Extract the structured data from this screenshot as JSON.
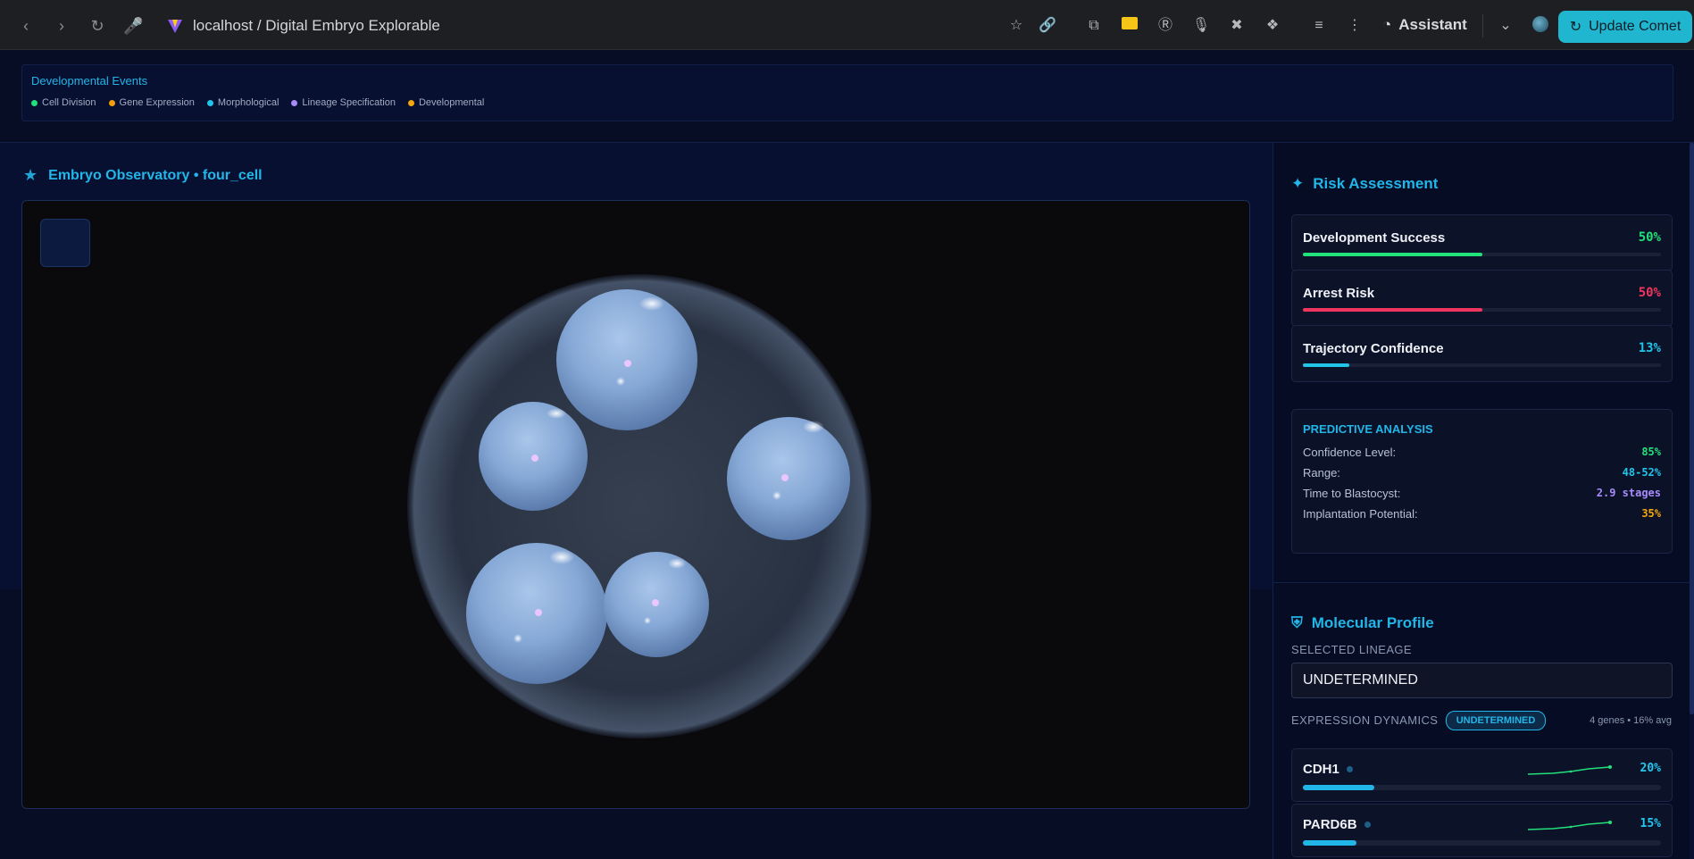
{
  "browser": {
    "url": "localhost / Digital Embryo Explorable",
    "assistant_label": "Assistant",
    "update_label": "Update Comet"
  },
  "events": {
    "title": "Developmental Events",
    "legend": [
      {
        "label": "Cell Division",
        "color": "#22e07a"
      },
      {
        "label": "Gene Expression",
        "color": "#f59e0b"
      },
      {
        "label": "Morphological",
        "color": "#22c4e8"
      },
      {
        "label": "Lineage Specification",
        "color": "#a78bfa"
      },
      {
        "label": "Developmental",
        "color": "#f5a70b"
      }
    ]
  },
  "observatory": {
    "title": "Embryo Observatory • four_cell"
  },
  "risk": {
    "title": "Risk Assessment",
    "metrics": [
      {
        "label": "Development Success",
        "value": "50%",
        "fraction": 0.5,
        "color": "#22e07a"
      },
      {
        "label": "Arrest Risk",
        "value": "50%",
        "fraction": 0.5,
        "color": "#f0365e"
      },
      {
        "label": "Trajectory Confidence",
        "value": "13%",
        "fraction": 0.13,
        "color": "#22c4e8"
      }
    ],
    "predictive": {
      "title": "PREDICTIVE ANALYSIS",
      "rows": [
        {
          "label": "Confidence Level:",
          "value": "85%",
          "color": "#22e07a"
        },
        {
          "label": "Range:",
          "value": "48-52%",
          "color": "#22c4e8"
        },
        {
          "label": "Time to Blastocyst:",
          "value": "2.9 stages",
          "color": "#a78bfa"
        },
        {
          "label": "Implantation Potential:",
          "value": "35%",
          "color": "#f5a70b"
        }
      ]
    }
  },
  "molecular": {
    "title": "Molecular Profile",
    "selected_lineage_label": "SELECTED LINEAGE",
    "selected_lineage": "UNDETERMINED",
    "expression_label": "EXPRESSION DYNAMICS",
    "expression_badge": "UNDETERMINED",
    "summary": "4 genes • 16% avg",
    "genes": [
      {
        "name": "CDH1",
        "value": "20%",
        "fraction": 0.2
      },
      {
        "name": "PARD6B",
        "value": "15%",
        "fraction": 0.15
      }
    ]
  }
}
